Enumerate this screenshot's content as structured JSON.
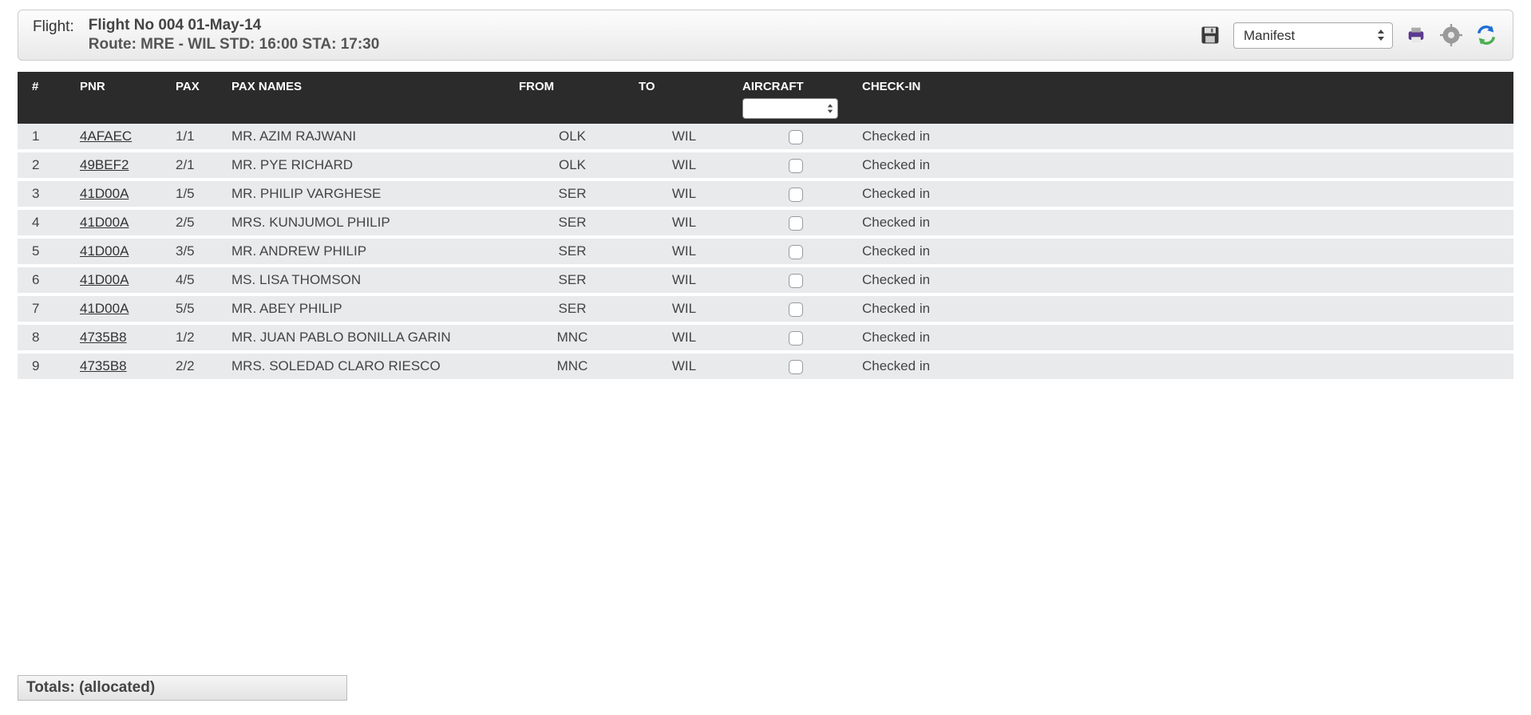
{
  "header": {
    "flight_label": "Flight:",
    "line1": "Flight No 004  01-May-14",
    "line2": "Route: MRE - WIL   STD: 16:00 STA: 17:30",
    "view_select": "Manifest"
  },
  "columns": {
    "idx": "#",
    "pnr": "PNR",
    "pax": "PAX",
    "names": "PAX NAMES",
    "from": "FROM",
    "to": "TO",
    "aircraft": "AIRCRAFT",
    "checkin": "CHECK-IN"
  },
  "aircraft_filter": "",
  "rows": [
    {
      "idx": "1",
      "pnr": "4AFAEC",
      "pax": "1/1",
      "name": "MR. AZIM RAJWANI",
      "from": "OLK",
      "to": "WIL",
      "checkin": "Checked in"
    },
    {
      "idx": "2",
      "pnr": "49BEF2",
      "pax": "2/1",
      "name": "MR. PYE RICHARD",
      "from": "OLK",
      "to": "WIL",
      "checkin": "Checked in"
    },
    {
      "idx": "3",
      "pnr": "41D00A",
      "pax": "1/5",
      "name": "MR. PHILIP VARGHESE",
      "from": "SER",
      "to": "WIL",
      "checkin": "Checked in"
    },
    {
      "idx": "4",
      "pnr": "41D00A",
      "pax": "2/5",
      "name": "MRS. KUNJUMOL PHILIP",
      "from": "SER",
      "to": "WIL",
      "checkin": "Checked in"
    },
    {
      "idx": "5",
      "pnr": "41D00A",
      "pax": "3/5",
      "name": "MR. ANDREW PHILIP",
      "from": "SER",
      "to": "WIL",
      "checkin": "Checked in"
    },
    {
      "idx": "6",
      "pnr": "41D00A",
      "pax": "4/5",
      "name": "MS. LISA THOMSON",
      "from": "SER",
      "to": "WIL",
      "checkin": "Checked in"
    },
    {
      "idx": "7",
      "pnr": "41D00A",
      "pax": "5/5",
      "name": "MR. ABEY PHILIP",
      "from": "SER",
      "to": "WIL",
      "checkin": "Checked in"
    },
    {
      "idx": "8",
      "pnr": "4735B8",
      "pax": "1/2",
      "name": "MR. JUAN PABLO BONILLA GARIN",
      "from": "MNC",
      "to": "WIL",
      "checkin": "Checked in"
    },
    {
      "idx": "9",
      "pnr": "4735B8",
      "pax": "2/2",
      "name": "MRS. SOLEDAD CLARO RIESCO",
      "from": "MNC",
      "to": "WIL",
      "checkin": "Checked in"
    }
  ],
  "totals": "Totals: (allocated)"
}
